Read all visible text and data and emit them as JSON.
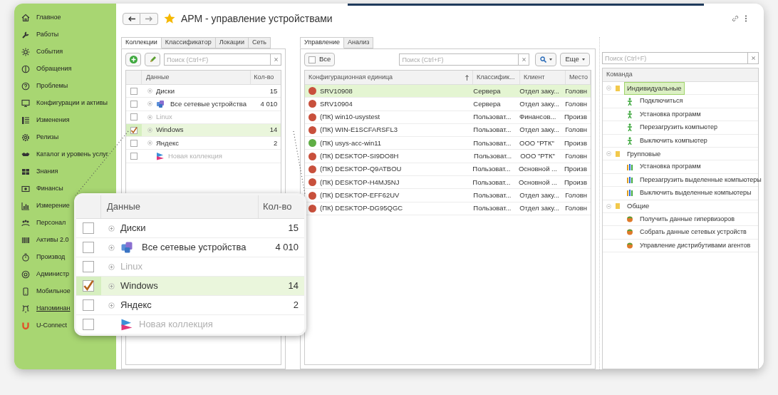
{
  "sidebar": {
    "items": [
      {
        "label": "Главное",
        "underlined": false
      },
      {
        "label": "Работы",
        "underlined": false
      },
      {
        "label": "События",
        "underlined": false
      },
      {
        "label": "Обращения",
        "underlined": false
      },
      {
        "label": "Проблемы",
        "underlined": false
      },
      {
        "label": "Конфигурации и активы",
        "underlined": false
      },
      {
        "label": "Изменения",
        "underlined": false
      },
      {
        "label": "Релизы",
        "underlined": false
      },
      {
        "label": "Каталог и уровень услуг",
        "underlined": false
      },
      {
        "label": "Знания",
        "underlined": false
      },
      {
        "label": "Финансы",
        "underlined": false
      },
      {
        "label": "Измерение",
        "underlined": false
      },
      {
        "label": "Персонал",
        "underlined": false
      },
      {
        "label": "Активы 2.0",
        "underlined": false
      },
      {
        "label": "Производ",
        "underlined": false
      },
      {
        "label": "Администр",
        "underlined": false
      },
      {
        "label": "Мобильное",
        "underlined": false
      },
      {
        "label": "Напоминан",
        "underlined": true
      },
      {
        "label": "U-Connect",
        "underlined": false
      }
    ]
  },
  "header": {
    "title": "АРМ - управление устройствами",
    "favorite": true
  },
  "collections_panel": {
    "tabs": [
      {
        "label": "Коллекции",
        "selected": true
      },
      {
        "label": "Классификатор",
        "selected": false
      },
      {
        "label": "Локации",
        "selected": false
      },
      {
        "label": "Сеть",
        "selected": false
      }
    ],
    "search": {
      "placeholder": "Поиск (Ctrl+F)"
    },
    "columns": [
      "Данные",
      "Кол-во"
    ],
    "rows": [
      {
        "kind": "group",
        "name": "Диски",
        "count": "15",
        "checked": false,
        "selected": false,
        "dimmed": false
      },
      {
        "kind": "network",
        "name": "Все сетевые устройства",
        "count": "4 010",
        "checked": false,
        "selected": false,
        "dimmed": false
      },
      {
        "kind": "group",
        "name": "Linux",
        "checked": false,
        "selected": false,
        "dimmed": true
      },
      {
        "kind": "group",
        "name": "Windows",
        "count": "14",
        "checked": true,
        "selected": true,
        "dimmed": false
      },
      {
        "kind": "group",
        "name": "Яндекс",
        "count": "2",
        "checked": false,
        "selected": false,
        "dimmed": false
      },
      {
        "kind": "new",
        "name": "Новая коллекция",
        "checked": false,
        "selected": false,
        "dimmed": true
      }
    ]
  },
  "devices_panel": {
    "tabs": [
      {
        "label": "Управление",
        "selected": true
      },
      {
        "label": "Анализ",
        "selected": false
      }
    ],
    "all_button": {
      "label": "Все",
      "checked": false
    },
    "search": {
      "placeholder": "Поиск (Ctrl+F)"
    },
    "more_button": "Еще",
    "columns": [
      "Конфигурационная единица",
      "Классифик...",
      "Клиент",
      "Место"
    ],
    "rows": [
      {
        "name": "SRV10908",
        "classifier": "Сервера",
        "client": "Отдел заку...",
        "location": "Головн",
        "color": "#c8503c",
        "selected": true
      },
      {
        "name": "SRV10904",
        "classifier": "Сервера",
        "client": "Отдел заку...",
        "location": "Головн",
        "color": "#c8503c",
        "selected": false
      },
      {
        "name": "(ПК) win10-usystest",
        "classifier": "Пользоват...",
        "client": "Финансов...",
        "location": "Произв",
        "color": "#c8503c",
        "selected": false
      },
      {
        "name": "(ПК) WIN-E1SCFARSFL3",
        "classifier": "Пользоват...",
        "client": "Отдел заку...",
        "location": "Головн",
        "color": "#c8503c",
        "selected": false
      },
      {
        "name": "(ПК) usys-acc-win11",
        "classifier": "Пользоват...",
        "client": "ООО \"РТК\"",
        "location": "Произв",
        "color": "#5fae45",
        "selected": false
      },
      {
        "name": "(ПК) DESKTOP-SI9DO8H",
        "classifier": "Пользоват...",
        "client": "ООО \"РТК\"",
        "location": "Головн",
        "color": "#c8503c",
        "selected": false
      },
      {
        "name": "(ПК) DESKTOP-Q9ATBOU",
        "classifier": "Пользоват...",
        "client": "Основной ...",
        "location": "Произв",
        "color": "#c8503c",
        "selected": false
      },
      {
        "name": "(ПК) DESKTOP-H4MJ5NJ",
        "classifier": "Пользоват...",
        "client": "Основной ...",
        "location": "Произв",
        "color": "#c8503c",
        "selected": false
      },
      {
        "name": "(ПК) DESKTOP-EFF62UV",
        "classifier": "Пользоват...",
        "client": "Отдел заку...",
        "location": "Головн",
        "color": "#c8503c",
        "selected": false
      },
      {
        "name": "(ПК) DESKTOP-DG95QGC",
        "classifier": "Пользоват...",
        "client": "Отдел заку...",
        "location": "Головн",
        "color": "#c8503c",
        "selected": false
      }
    ]
  },
  "commands_panel": {
    "search": {
      "placeholder": "Поиск (Ctrl+F)"
    },
    "column": "Команда",
    "groups": [
      {
        "label": "Индивидуальные",
        "selected": true,
        "expanded": true,
        "children": [
          {
            "label": "Подключиться",
            "kind": "single"
          },
          {
            "label": "Установка программ",
            "kind": "single"
          },
          {
            "label": "Перезагрузить компьютер",
            "kind": "single"
          },
          {
            "label": "Выключить компьютер",
            "kind": "single"
          }
        ]
      },
      {
        "label": "Групповые",
        "selected": false,
        "expanded": true,
        "children": [
          {
            "label": "Установка программ",
            "kind": "group"
          },
          {
            "label": "Перезагрузить выделенные компьютеры",
            "kind": "group"
          },
          {
            "label": "Выключить выделенные компьютеры",
            "kind": "group"
          }
        ]
      },
      {
        "label": "Общие",
        "selected": false,
        "expanded": true,
        "children": [
          {
            "label": "Получить данные гипервизоров",
            "kind": "common"
          },
          {
            "label": "Собрать данные сетевых устройств",
            "kind": "common"
          },
          {
            "label": "Управление дистрибутивами агентов",
            "kind": "common"
          }
        ]
      }
    ]
  },
  "zoom_overlay": {
    "columns": [
      "Данные",
      "Кол-во"
    ],
    "rows": [
      {
        "kind": "group",
        "name": "Диски",
        "count": "15",
        "checked": false,
        "selected": false,
        "dimmed": false
      },
      {
        "kind": "network",
        "name": "Все сетевые устройства",
        "count": "4 010",
        "checked": false,
        "selected": false,
        "dimmed": false
      },
      {
        "kind": "group",
        "name": "Linux",
        "checked": false,
        "selected": false,
        "dimmed": true
      },
      {
        "kind": "group",
        "name": "Windows",
        "count": "14",
        "checked": true,
        "selected": true,
        "dimmed": false
      },
      {
        "kind": "group",
        "name": "Яндекс",
        "count": "2",
        "checked": false,
        "selected": false,
        "dimmed": false
      },
      {
        "kind": "new",
        "name": "Новая коллекция",
        "checked": false,
        "selected": false,
        "dimmed": true
      }
    ]
  }
}
